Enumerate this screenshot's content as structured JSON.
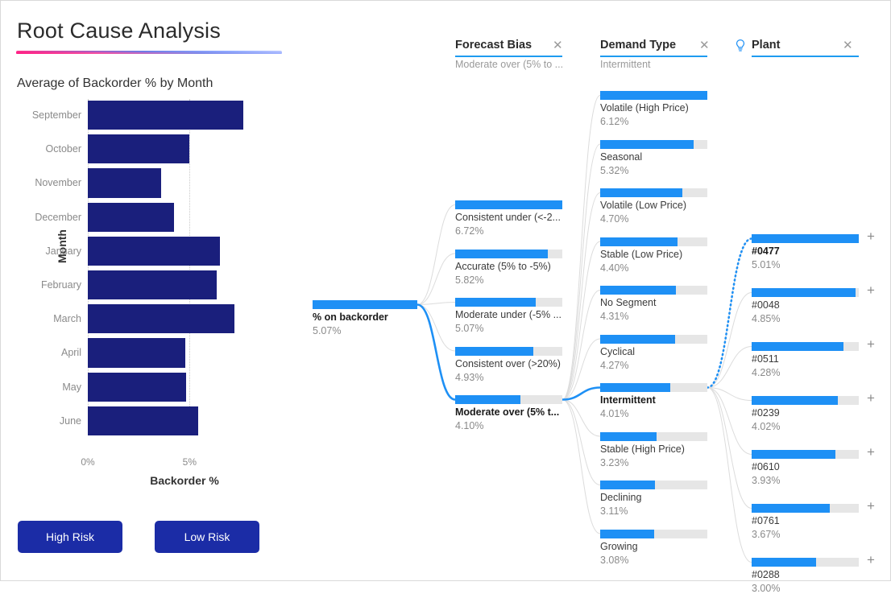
{
  "page": {
    "title": "Root Cause Analysis"
  },
  "chart_data": {
    "type": "bar",
    "title": "Average of Backorder % by Month",
    "xlabel": "Backorder %",
    "ylabel": "Month",
    "orientation": "horizontal",
    "xlim": [
      0,
      9.5
    ],
    "ticks": [
      "0%",
      "5%"
    ],
    "tick_values": [
      0,
      5
    ],
    "grid": true,
    "bar_color": "#1a1f7c",
    "categories": [
      "September",
      "October",
      "November",
      "December",
      "January",
      "February",
      "March",
      "April",
      "May",
      "June"
    ],
    "values": [
      7.62,
      5.0,
      3.61,
      4.25,
      6.51,
      6.32,
      7.22,
      4.8,
      4.83,
      5.42
    ]
  },
  "buttons": {
    "high_risk": "High Risk",
    "low_risk": "Low Risk"
  },
  "tree": {
    "root": {
      "name": "% on backorder",
      "value": "5.07%",
      "ratio": 1.0,
      "selected": true
    },
    "columns": [
      {
        "id": "forecast-bias",
        "header": "Forecast Bias",
        "subtitle": "Moderate over (5% to ...",
        "has_bulb": false,
        "close_label": "✕",
        "nodes": [
          {
            "name": "Consistent under (<-2...",
            "value": "6.72%",
            "ratio": 1.0,
            "selected": false
          },
          {
            "name": "Accurate (5% to -5%)",
            "value": "5.82%",
            "ratio": 0.866,
            "selected": false
          },
          {
            "name": "Moderate under (-5% ...",
            "value": "5.07%",
            "ratio": 0.754,
            "selected": false
          },
          {
            "name": "Consistent over (>20%)",
            "value": "4.93%",
            "ratio": 0.733,
            "selected": false
          },
          {
            "name": "Moderate over (5% t...",
            "value": "4.10%",
            "ratio": 0.61,
            "selected": true
          }
        ]
      },
      {
        "id": "demand-type",
        "header": "Demand Type",
        "subtitle": "Intermittent",
        "has_bulb": false,
        "close_label": "✕",
        "nodes": [
          {
            "name": "Volatile (High Price)",
            "value": "6.12%",
            "ratio": 1.0,
            "selected": false
          },
          {
            "name": "Seasonal",
            "value": "5.32%",
            "ratio": 0.869,
            "selected": false
          },
          {
            "name": "Volatile (Low Price)",
            "value": "4.70%",
            "ratio": 0.768,
            "selected": false
          },
          {
            "name": "Stable (Low Price)",
            "value": "4.40%",
            "ratio": 0.719,
            "selected": false
          },
          {
            "name": "No Segment",
            "value": "4.31%",
            "ratio": 0.704,
            "selected": false
          },
          {
            "name": "Cyclical",
            "value": "4.27%",
            "ratio": 0.698,
            "selected": false
          },
          {
            "name": "Intermittent",
            "value": "4.01%",
            "ratio": 0.655,
            "selected": true
          },
          {
            "name": "Stable (High Price)",
            "value": "3.23%",
            "ratio": 0.528,
            "selected": false
          },
          {
            "name": "Declining",
            "value": "3.11%",
            "ratio": 0.508,
            "selected": false
          },
          {
            "name": "Growing",
            "value": "3.08%",
            "ratio": 0.503,
            "selected": false
          }
        ]
      },
      {
        "id": "plant",
        "header": "Plant",
        "subtitle": "",
        "has_bulb": true,
        "bulb_icon": "lightbulb-icon",
        "close_label": "✕",
        "expand_icon": "+",
        "nodes": [
          {
            "name": "#0477",
            "value": "5.01%",
            "ratio": 1.0,
            "selected": true
          },
          {
            "name": "#0048",
            "value": "4.85%",
            "ratio": 0.968,
            "selected": false
          },
          {
            "name": "#0511",
            "value": "4.28%",
            "ratio": 0.854,
            "selected": false
          },
          {
            "name": "#0239",
            "value": "4.02%",
            "ratio": 0.802,
            "selected": false
          },
          {
            "name": "#0610",
            "value": "3.93%",
            "ratio": 0.784,
            "selected": false
          },
          {
            "name": "#0761",
            "value": "3.67%",
            "ratio": 0.733,
            "selected": false
          },
          {
            "name": "#0288",
            "value": "3.00%",
            "ratio": 0.599,
            "selected": false
          }
        ]
      }
    ]
  },
  "colors": {
    "bar_navy": "#1a1f7c",
    "accent_blue": "#1e90f5",
    "track_gray": "#e6e6e6",
    "button_blue": "#1b2ca6"
  }
}
